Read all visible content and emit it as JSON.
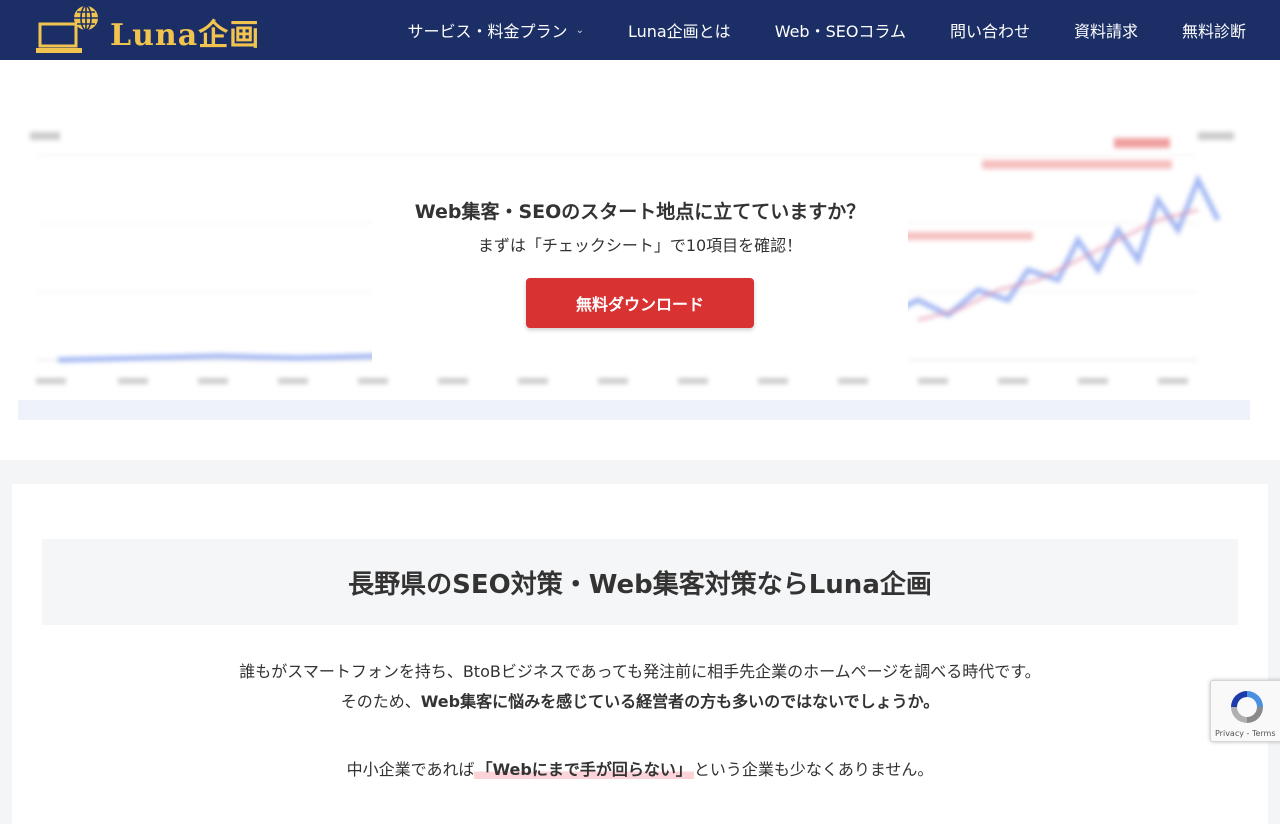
{
  "header": {
    "logo_text": "Luna企画",
    "nav": [
      {
        "label": "サービス・料金プラン",
        "has_dropdown": true
      },
      {
        "label": "Luna企画とは"
      },
      {
        "label": "Web・SEOコラム"
      },
      {
        "label": "問い合わせ"
      },
      {
        "label": "資料請求"
      },
      {
        "label": "無料診断"
      }
    ]
  },
  "popup": {
    "title": "Web集客・SEOのスタート地点に立てていますか？",
    "subtitle": "まずは「チェックシート」で10項目を確認！",
    "button_label": "無料ダウンロード"
  },
  "main": {
    "section_title": "長野県のSEO対策・Web集客対策ならLuna企画",
    "para1_line1": "誰もがスマートフォンを持ち、BtoBビジネスであっても発注前に相手先企業のホームページを調べる時代です。",
    "para1_line2_prefix": "そのため、",
    "para1_line2_bold": "Web集客に悩みを感じている経営者の方も多いのではないでしょうか。",
    "para2_prefix": "中小企業であれば",
    "para2_marked": "「Webにまで手が回らない」",
    "para2_suffix": "という企業も少なくありません。"
  },
  "recaptcha": {
    "links": "Privacy - Terms"
  },
  "colors": {
    "header_bg": "#1b2f66",
    "logo_gold": "#f0c44f",
    "button_red": "#d93232",
    "highlight_pink": "#fbd3d8"
  }
}
